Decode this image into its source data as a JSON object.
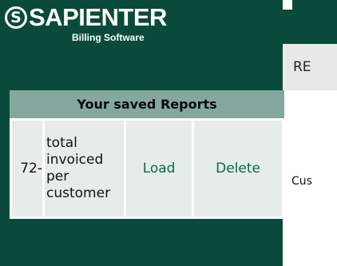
{
  "brand": {
    "mark": "S",
    "name": "SAPIENTER",
    "subtitle": "Billing Software"
  },
  "sidebar": {
    "saved_reports": {
      "title": "Your saved Reports",
      "rows": [
        {
          "id": "72-",
          "name": "total invoiced per customer",
          "load_label": "Load",
          "delete_label": "Delete"
        }
      ]
    }
  },
  "main": {
    "tab_label": "RE",
    "customer_label": "Cus"
  }
}
